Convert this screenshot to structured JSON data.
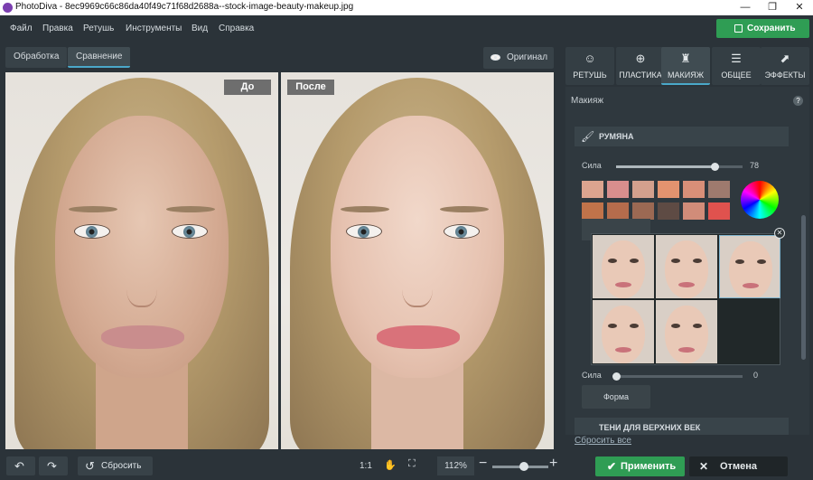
{
  "window": {
    "title": "PhotoDiva - 8ec9969c66c86da40f49c71f68d2688a--stock-image-beauty-makeup.jpg",
    "minimize": "—",
    "maximize": "❐",
    "close": "✕"
  },
  "menu": {
    "items": [
      "Файл",
      "Правка",
      "Ретушь",
      "Инструменты",
      "Вид",
      "Справка"
    ],
    "save_label": "Сохранить"
  },
  "view": {
    "tabs": [
      "Обработка",
      "Сравнение"
    ],
    "original_label": "Оригинал",
    "before_label": "До",
    "after_label": "После"
  },
  "right_tabs": [
    {
      "label": "РЕТУШЬ",
      "icon": "retouch-icon"
    },
    {
      "label": "ПЛАСТИКА",
      "icon": "plastic-icon"
    },
    {
      "label": "МАКИЯЖ",
      "icon": "makeup-icon"
    },
    {
      "label": "ОБЩЕЕ",
      "icon": "sliders-icon"
    },
    {
      "label": "ЭФФЕКТЫ",
      "icon": "effects-icon"
    }
  ],
  "panel": {
    "title": "Макияж",
    "help": "?",
    "blush_title": "РУМЯНА",
    "strength_label": "Сила",
    "strength_value": "78",
    "strength_fraction": 0.78,
    "strength2_label": "Сила",
    "strength2_value": "0",
    "strength2_fraction": 0,
    "shape_button": "Форма",
    "next_section": "ТЕНИ ДЛЯ ВЕРХНИХ ВЕК",
    "reset_all": "Сбросить все",
    "swatches": [
      "#dca48f",
      "#d88e8d",
      "#d3a08d",
      "#e3936f",
      "#d88f78",
      "#9e7a6e",
      "#c0734a",
      "#b56c4c",
      "#9b6953",
      "#5e4b44",
      "#d18c79",
      "#e0524e"
    ]
  },
  "bottom": {
    "reset_label": "Сбросить",
    "one_to_one": "1:1",
    "zoom_value": "112%",
    "zoom_fraction": 0.56,
    "apply_label": "Применить",
    "cancel_label": "Отмена"
  },
  "colors": {
    "accent_green": "#2f9d54",
    "active_tab_underline": "#4aa8c9"
  }
}
